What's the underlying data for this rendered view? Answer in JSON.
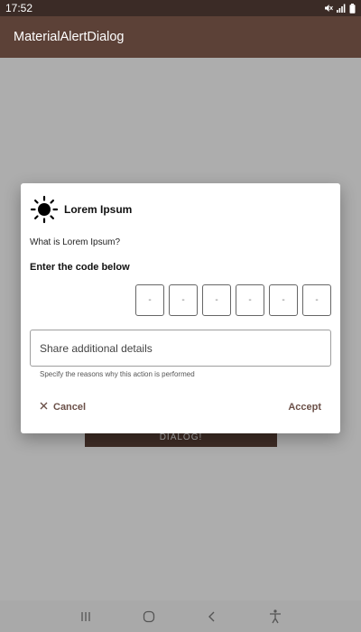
{
  "status_bar": {
    "time": "17:52",
    "icons": [
      "mute-icon",
      "signal-icon",
      "battery-icon"
    ]
  },
  "app_bar": {
    "title": "MaterialAlertDialog"
  },
  "background": {
    "button_label": "DIALOG!"
  },
  "dialog": {
    "icon": "sun-icon",
    "title": "Lorem Ipsum",
    "message": "What is Lorem Ipsum?",
    "code_label": "Enter the code below",
    "code_boxes": [
      "-",
      "-",
      "-",
      "-",
      "-",
      "-"
    ],
    "field": {
      "placeholder": "Share additional details",
      "helper": "Specify the reasons why this action is performed"
    },
    "cancel_label": "Cancel",
    "accept_label": "Accept"
  },
  "nav_bar": {
    "icons": [
      "recents-icon",
      "home-icon",
      "back-icon",
      "accessibility-icon"
    ]
  },
  "colors": {
    "primary": "#5c4137",
    "status_bar": "#3b2b26",
    "button_text": "#6b5048",
    "nav_bar": "#a9a9a9"
  }
}
